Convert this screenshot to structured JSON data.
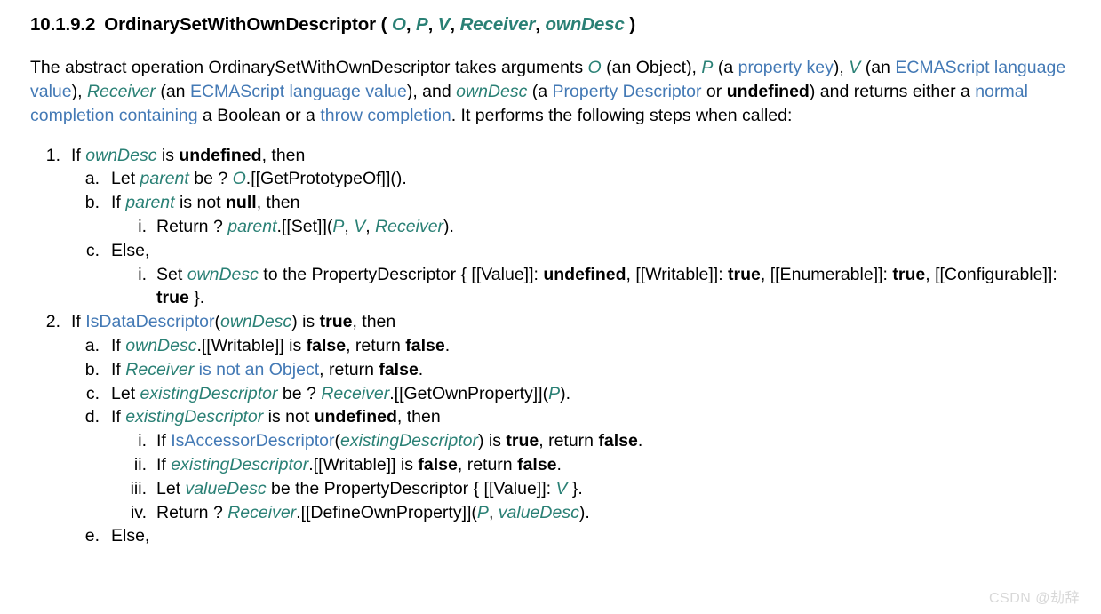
{
  "heading": {
    "number": "10.1.9.2",
    "name": "OrdinarySetWithOwnDescriptor",
    "open_paren": "(",
    "close_paren": ")",
    "params": [
      "O",
      "P",
      "V",
      "Receiver",
      "ownDesc"
    ],
    "separator": ", "
  },
  "intro": {
    "t1": "The abstract operation OrdinarySetWithOwnDescriptor takes arguments ",
    "v_O": "O",
    "t2": " (an Object), ",
    "v_P": "P",
    "t3": " (a ",
    "l_property_key": "property key",
    "t4": "), ",
    "v_V": "V",
    "t5": " (an ",
    "l_lang_value_1": "ECMAScript language value",
    "t6": "), ",
    "v_Receiver": "Receiver",
    "t7": " (an ",
    "l_lang_value_2": "ECMAScript language value",
    "t8": "), and ",
    "v_ownDesc": "ownDesc",
    "t9": " (a ",
    "l_property_descriptor": "Property Descriptor",
    "t10": " or ",
    "b_undefined": "undefined",
    "t11": ") and returns either a ",
    "l_normal_completion": "normal completion containing",
    "t12": " a Boolean or a ",
    "l_throw_completion": "throw completion",
    "t13": ". It performs the following steps when called:"
  },
  "markers": {
    "m1": "1.",
    "m2": "2.",
    "a": "a.",
    "b": "b.",
    "c": "c.",
    "d": "d.",
    "e": "e.",
    "i": "i.",
    "ii": "ii.",
    "iii": "iii.",
    "iv": "iv."
  },
  "steps": {
    "s1": {
      "t1": "If ",
      "var1": "ownDesc",
      "t2": " is ",
      "kw1": "undefined",
      "t3": ", then"
    },
    "s1a": {
      "t1": "Let ",
      "var1": "parent",
      "t2": " be ? ",
      "var2": "O",
      "t3": ".[[GetPrototypeOf]]()."
    },
    "s1b": {
      "t1": "If ",
      "var1": "parent",
      "t2": " is not ",
      "kw1": "null",
      "t3": ", then"
    },
    "s1bi": {
      "t1": "Return ? ",
      "var1": "parent",
      "t2": ".[[Set]](",
      "var2": "P",
      "t3": ", ",
      "var3": "V",
      "t4": ", ",
      "var4": "Receiver",
      "t5": ")."
    },
    "s1c": {
      "t1": "Else,"
    },
    "s1ci": {
      "t1": "Set ",
      "var1": "ownDesc",
      "t2": " to the PropertyDescriptor { [[Value]]: ",
      "kw1": "undefined",
      "t3": ", [[Writable]]: ",
      "kw2": "true",
      "t4": ", [[Enumerable]]: ",
      "kw3": "true",
      "t5": ", [[Configurable]]: ",
      "kw4": "true",
      "t6": " }."
    },
    "s2": {
      "t1": "If ",
      "link1": "IsDataDescriptor",
      "t2": "(",
      "var1": "ownDesc",
      "t3": ") is ",
      "kw1": "true",
      "t4": ", then"
    },
    "s2a": {
      "t1": "If ",
      "var1": "ownDesc",
      "t2": ".[[Writable]] is ",
      "kw1": "false",
      "t3": ", return ",
      "kw2": "false",
      "t4": "."
    },
    "s2b": {
      "t1": "If ",
      "var1": "Receiver",
      "link1": " is not an Object",
      "t2": ", return ",
      "kw1": "false",
      "t3": "."
    },
    "s2c": {
      "t1": "Let ",
      "var1": "existingDescriptor",
      "t2": " be ? ",
      "var2": "Receiver",
      "t3": ".[[GetOwnProperty]](",
      "var3": "P",
      "t4": ")."
    },
    "s2d": {
      "t1": "If ",
      "var1": "existingDescriptor",
      "t2": " is not ",
      "kw1": "undefined",
      "t3": ", then"
    },
    "s2di": {
      "t1": "If ",
      "link1": "IsAccessorDescriptor",
      "t2": "(",
      "var1": "existingDescriptor",
      "t3": ") is ",
      "kw1": "true",
      "t4": ", return ",
      "kw2": "false",
      "t5": "."
    },
    "s2dii": {
      "t1": "If ",
      "var1": "existingDescriptor",
      "t2": ".[[Writable]] is ",
      "kw1": "false",
      "t3": ", return ",
      "kw2": "false",
      "t4": "."
    },
    "s2diii": {
      "t1": "Let ",
      "var1": "valueDesc",
      "t2": " be the PropertyDescriptor { [[Value]]: ",
      "var2": "V",
      "t3": " }."
    },
    "s2div": {
      "t1": "Return ? ",
      "var1": "Receiver",
      "t2": ".[[DefineOwnProperty]](",
      "var2": "P",
      "t3": ", ",
      "var3": "valueDesc",
      "t4": ")."
    },
    "s2e": {
      "t1": "Else,"
    }
  },
  "watermark": "CSDN @劫辞",
  "colors": {
    "variable_teal": "#2a8075",
    "link_blue": "#4379b5",
    "text_black": "#000000",
    "watermark_gray": "#d8d8d8",
    "background": "#ffffff"
  }
}
